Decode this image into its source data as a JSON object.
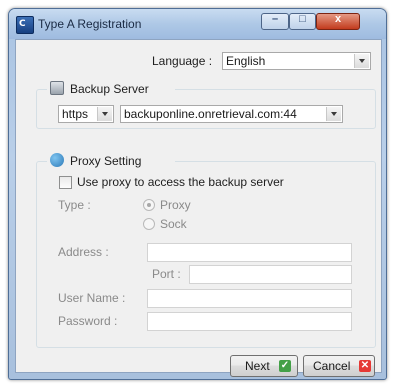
{
  "window": {
    "title": "Type A Registration",
    "minimize_glyph": "–",
    "maximize_glyph": "□",
    "close_glyph": "x"
  },
  "language": {
    "label": "Language :",
    "value": "English"
  },
  "backup_server": {
    "title": "Backup Server",
    "icon": "server-icon",
    "protocol": "https",
    "address": "backuponline.onretrieval.com:44"
  },
  "proxy": {
    "title": "Proxy Setting",
    "icon": "globe-network-icon",
    "use_proxy_label": "Use proxy to access the backup server",
    "use_proxy_checked": false,
    "type_label": "Type :",
    "type_options": [
      "Proxy",
      "Sock"
    ],
    "type_selected": "Proxy",
    "address_label": "Address :",
    "address_value": "",
    "port_label": "Port :",
    "port_value": "",
    "username_label": "User Name :",
    "username_value": "",
    "password_label": "Password :",
    "password_value": ""
  },
  "buttons": {
    "next": "Next",
    "cancel": "Cancel",
    "next_glyph": "✓",
    "cancel_glyph": "✕"
  },
  "colors": {
    "next_icon": "#43a047",
    "cancel_icon": "#e53935",
    "titlebar": "#aec8e6"
  }
}
